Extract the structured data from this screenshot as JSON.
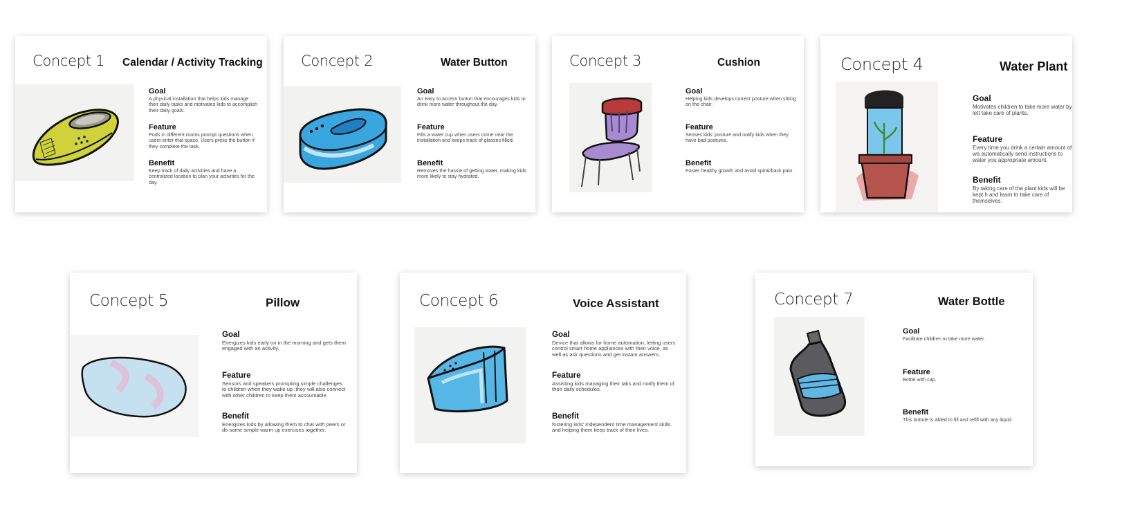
{
  "concepts": [
    {
      "label": "Concept 1",
      "name": "Calendar / Activity Tracking",
      "goal_title": "Goal",
      "goal": "A physical installation that helps kids manage their daily tasks and motivates kids to accomplish their daily goals.",
      "feature_title": "Feature",
      "feature": "Pods in different rooms prompt questions when users enter that space. Users press the button if they complete the task.",
      "benefit_title": "Benefit",
      "benefit": "Keep track of daily activities and have a centralized location to plan your activities for the day.",
      "sketch": "yellow-pod-sketch"
    },
    {
      "label": "Concept 2",
      "name": "Water Button",
      "goal_title": "Goal",
      "goal": "An easy to access button that encourages kids to drink more water throughout the day.",
      "feature_title": "Feature",
      "feature": "Fills a water cup when users come near the installation and keeps track of glasses filled.",
      "benefit_title": "Benefit",
      "benefit": "Removes the hassle of getting water, making kids more likely to stay hydrated.",
      "sketch": "blue-button-sketch"
    },
    {
      "label": "Concept 3",
      "name": "Cushion",
      "goal_title": "Goal",
      "goal": "Helping kids develops correct posture when sitting on the chair.",
      "feature_title": "Feature",
      "feature": "Senses kids' posture and notify kids when they have bad postures.",
      "benefit_title": "Benefit",
      "benefit": "Foster healthy growth and avoid spiral/back pain.",
      "sketch": "purple-chair-sketch"
    },
    {
      "label": "Concept 4",
      "name": "Water Plant",
      "goal_title": "Goal",
      "goal": "Motivates children to take more water by lett take care of plants.",
      "feature_title": "Feature",
      "feature": "Every time you drink a certain amount of wa automatically send instructions to water you appropriate amount.",
      "benefit_title": "Benefit",
      "benefit": "By taking care of the plant kids will be kept h and learn to take care of themselves.",
      "sketch": "potted-plant-sketch"
    },
    {
      "label": "Concept 5",
      "name": "Pillow",
      "goal_title": "Goal",
      "goal": "Energizes kids early on in the morning and gets them engaged with an activity.",
      "feature_title": "Feature",
      "feature": "Sensors and speakers prompting simple challenges to children when they wake up ,they will also connect with other children to keep them accountable.",
      "benefit_title": "Benefit",
      "benefit": "Energizes kids by allowing them to chat with peers or do some simple warm up exercises together.",
      "sketch": "pillow-sketch"
    },
    {
      "label": "Concept 6",
      "name": "Voice Assistant",
      "goal_title": "Goal",
      "goal": "Device that allows for home automation, letting users control smart home appliances with their voice, as well as ask questions and get instant answers.",
      "feature_title": "Feature",
      "feature": "Assisting kids managing their taks and notify them of their daily schedules.",
      "benefit_title": "Benefit",
      "benefit": "fostering kids' independent time management skills and helping them keep track of their lives.",
      "sketch": "speaker-sketch"
    },
    {
      "label": "Concept 7",
      "name": "Water Bottle",
      "goal_title": "Goal",
      "goal": "Facilitate children to take more water.",
      "feature_title": "Feature",
      "feature": "Bottle with cap.",
      "benefit_title": "Benefit",
      "benefit": "This bottole is abled to fill and refill with any liquid.",
      "sketch": "water-bottle-sketch"
    }
  ]
}
